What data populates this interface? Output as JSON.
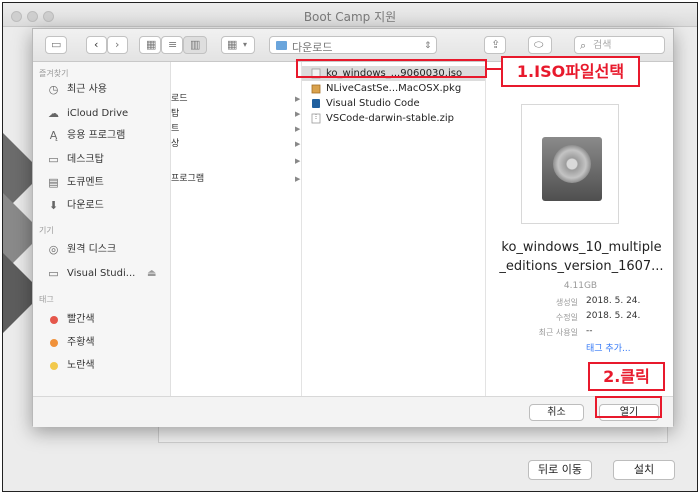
{
  "window": {
    "title": "Boot Camp 지원"
  },
  "toolbar": {
    "location_label": "다운로드",
    "search_placeholder": "검색"
  },
  "sidebar": {
    "sections": [
      {
        "heading": "즐겨찾기",
        "items": [
          {
            "label": "최근 사용",
            "icon": "clock-icon"
          },
          {
            "label": "iCloud Drive",
            "icon": "cloud-icon"
          },
          {
            "label": "응용 프로그램",
            "icon": "apps-icon"
          },
          {
            "label": "데스크탑",
            "icon": "desktop-icon"
          },
          {
            "label": "도큐멘트",
            "icon": "document-icon"
          },
          {
            "label": "다운로드",
            "icon": "download-icon"
          }
        ]
      },
      {
        "heading": "기기",
        "items": [
          {
            "label": "원격 디스크",
            "icon": "disc-icon"
          },
          {
            "label": "Visual Studi...",
            "icon": "drive-icon",
            "eject": "⏏"
          }
        ]
      },
      {
        "heading": "태그",
        "items": [
          {
            "label": "빨간색",
            "color": "#e5574b"
          },
          {
            "label": "주황색",
            "color": "#f0913a"
          },
          {
            "label": "노란색",
            "color": "#f2c94c"
          }
        ]
      }
    ]
  },
  "column1": {
    "items": [
      "로드",
      "탑",
      "트",
      "상",
      "",
      "프로그램"
    ]
  },
  "files": [
    {
      "name": "ko_windows_...9060030.iso",
      "icon": "iso-icon",
      "selected": true
    },
    {
      "name": "NLiveCastSe...MacOSX.pkg",
      "icon": "package-icon"
    },
    {
      "name": "Visual Studio Code",
      "icon": "vscode-icon"
    },
    {
      "name": "VSCode-darwin-stable.zip",
      "icon": "zip-icon"
    }
  ],
  "preview": {
    "name_line1": "ko_windows_10_multiple",
    "name_line2": "_editions_version_1607...",
    "size": "4.11GB",
    "meta": [
      {
        "key": "생성일",
        "value": "2018. 5. 24."
      },
      {
        "key": "수정일",
        "value": "2018. 5. 24."
      },
      {
        "key": "최근 사용일",
        "value": "--"
      },
      {
        "key": "",
        "value": "태그 추가..."
      }
    ]
  },
  "dialog_buttons": {
    "cancel": "취소",
    "open": "열기"
  },
  "annotations": {
    "step1": "1.ISO파일선택",
    "step2": "2.클릭"
  },
  "bottom_buttons": {
    "back": "뒤로 이동",
    "install": "설치"
  },
  "colors": {
    "annotation": "#e8192c",
    "folder": "#6aa5dc",
    "link": "#3478f6"
  }
}
